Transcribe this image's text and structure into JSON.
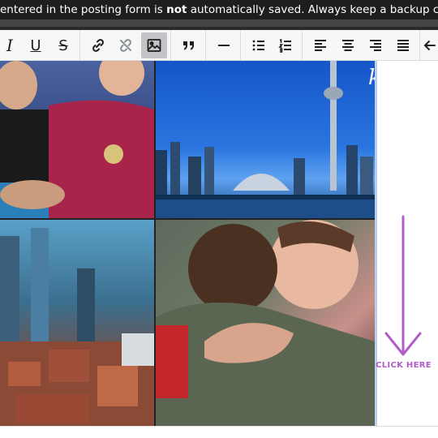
{
  "notice": {
    "prefix": "entered in the posting form is ",
    "emph": "not",
    "suffix": " automatically saved. Always keep a backup co"
  },
  "toolbar": {
    "buttons": [
      {
        "name": "italic-button",
        "icon": "italic-icon",
        "glyph": "I"
      },
      {
        "name": "underline-button",
        "icon": "underline-icon",
        "glyph": "U"
      },
      {
        "name": "strikethrough-button",
        "icon": "strikethrough-icon",
        "glyph": "S"
      },
      {
        "name": "insert-link-button",
        "icon": "link-icon"
      },
      {
        "name": "remove-link-button",
        "icon": "unlink-icon"
      },
      {
        "name": "insert-image-button",
        "icon": "image-icon",
        "active": true
      },
      {
        "name": "blockquote-button",
        "icon": "quote-icon"
      },
      {
        "name": "horizontal-rule-button",
        "icon": "horizontal-line-icon"
      },
      {
        "name": "bulleted-list-button",
        "icon": "bullet-list-icon"
      },
      {
        "name": "numbered-list-button",
        "icon": "numbered-list-icon"
      },
      {
        "name": "align-left-button",
        "icon": "align-left-icon"
      },
      {
        "name": "align-center-button",
        "icon": "align-center-icon"
      },
      {
        "name": "align-right-button",
        "icon": "align-right-icon"
      },
      {
        "name": "align-justify-button",
        "icon": "align-justify-icon"
      },
      {
        "name": "outdent-button",
        "icon": "arrow-left-icon"
      }
    ]
  },
  "content": {
    "image_caption": "known",
    "click_here": "CLICK HERE",
    "accent_color": "#b25cc7"
  }
}
